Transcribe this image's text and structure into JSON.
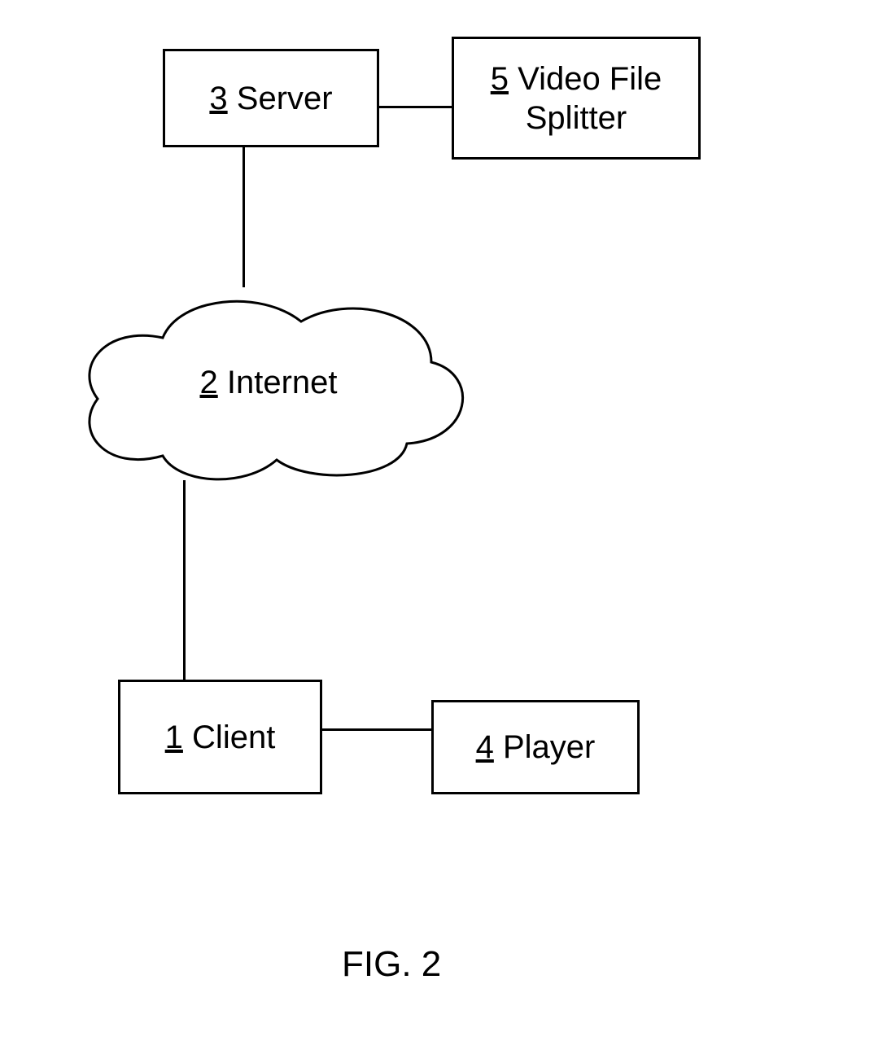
{
  "nodes": {
    "server": {
      "num": "3",
      "label": "Server"
    },
    "splitter": {
      "num": "5",
      "label": "Video File Splitter"
    },
    "internet": {
      "num": "2",
      "label": "Internet"
    },
    "client": {
      "num": "1",
      "label": "Client"
    },
    "player": {
      "num": "4",
      "label": "Player"
    }
  },
  "caption": "FIG. 2",
  "chart_data": {
    "type": "diagram",
    "title": "FIG. 2",
    "nodes": [
      {
        "id": 3,
        "label": "Server"
      },
      {
        "id": 5,
        "label": "Video File Splitter"
      },
      {
        "id": 2,
        "label": "Internet"
      },
      {
        "id": 1,
        "label": "Client"
      },
      {
        "id": 4,
        "label": "Player"
      }
    ],
    "edges": [
      {
        "from": 3,
        "to": 5
      },
      {
        "from": 3,
        "to": 2
      },
      {
        "from": 2,
        "to": 1
      },
      {
        "from": 1,
        "to": 4
      }
    ]
  }
}
